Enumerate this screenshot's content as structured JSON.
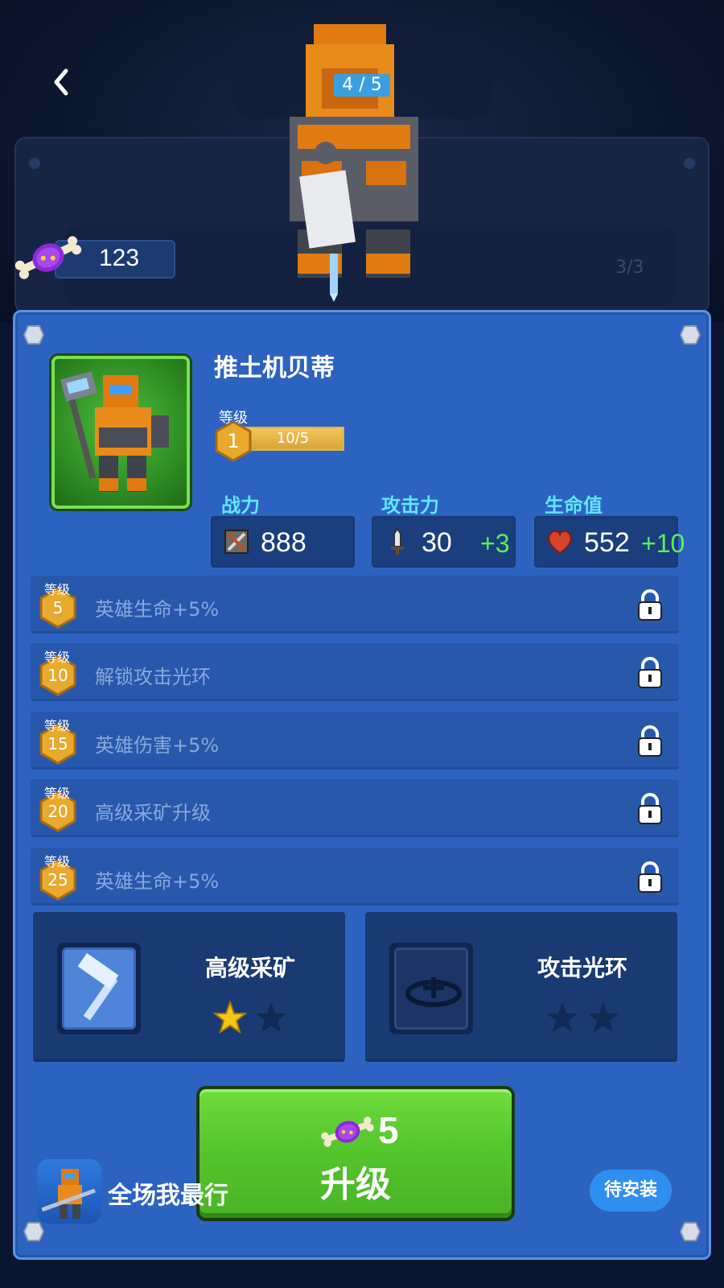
{
  "header": {
    "page_counter": "4 / 5",
    "back_label": "back"
  },
  "background": {
    "ghost_count": "3/3"
  },
  "currency": {
    "amount": "123",
    "icon": "candy-icon"
  },
  "hero": {
    "name": "推土机贝蒂",
    "level_label": "等级",
    "level": "1",
    "xp_text": "10/5",
    "xp_fraction": 1.0
  },
  "stats": [
    {
      "label": "战力",
      "icon": "power-icon",
      "value": "888",
      "bonus": ""
    },
    {
      "label": "攻击力",
      "icon": "sword-icon",
      "value": "30",
      "bonus": "+3"
    },
    {
      "label": "生命值",
      "icon": "heart-icon",
      "value": "552",
      "bonus": "+10"
    }
  ],
  "unlocks": [
    {
      "level_label": "等级",
      "level": "5",
      "text": "英雄生命+5%"
    },
    {
      "level_label": "等级",
      "level": "10",
      "text": "解锁攻击光环"
    },
    {
      "level_label": "等级",
      "level": "15",
      "text": "英雄伤害+5%"
    },
    {
      "level_label": "等级",
      "level": "20",
      "text": "高级采矿升级"
    },
    {
      "level_label": "等级",
      "level": "25",
      "text": "英雄生命+5%"
    }
  ],
  "skills": [
    {
      "title": "高级采矿",
      "icon": "hammer-icon",
      "stars": 2,
      "filled": 1
    },
    {
      "title": "攻击光环",
      "icon": "aura-icon",
      "stars": 2,
      "filled": 0
    }
  ],
  "upgrade": {
    "cost": "5",
    "label": "升级"
  },
  "ad": {
    "title": "全场我最行",
    "install_label": "待安装"
  },
  "colors": {
    "panel": "#2d63c0",
    "stat_label": "#5fe6ff",
    "bonus": "#5cf04f",
    "upgrade_button": "#56c62d",
    "star_filled": "#f5c518",
    "star_empty": "#0f2a55"
  }
}
